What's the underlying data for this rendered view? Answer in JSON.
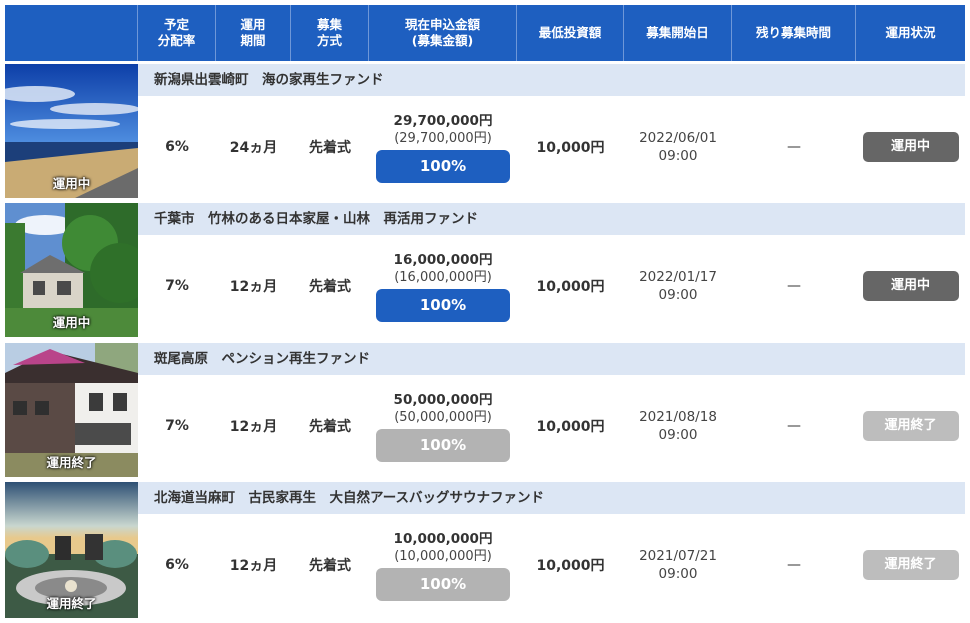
{
  "header": {
    "columns": [
      "予定\n分配率",
      "運用\n期間",
      "募集\n方式",
      "現在申込金額\n(募集金額)",
      "最低投資額",
      "募集開始日",
      "残り募集時間",
      "運用状況"
    ]
  },
  "funds": [
    {
      "name": "新潟県出雲崎町　海の家再生ファンド",
      "thumb_label": "運用中",
      "rate": "6%",
      "period": "24ヵ月",
      "method": "先着式",
      "amount": "29,700,000円",
      "target": "(29,700,000円)",
      "percent": "100%",
      "min_investment": "10,000円",
      "start_date": "2022/06/01\n09:00",
      "remaining": "—",
      "status": "運用中"
    },
    {
      "name": "千葉市　竹林のある日本家屋・山林　再活用ファンド",
      "thumb_label": "運用中",
      "rate": "7%",
      "period": "12ヵ月",
      "method": "先着式",
      "amount": "16,000,000円",
      "target": "(16,000,000円)",
      "percent": "100%",
      "min_investment": "10,000円",
      "start_date": "2022/01/17\n09:00",
      "remaining": "—",
      "status": "運用中"
    },
    {
      "name": "斑尾高原　ペンション再生ファンド",
      "thumb_label": "運用終了",
      "rate": "7%",
      "period": "12ヵ月",
      "method": "先着式",
      "amount": "50,000,000円",
      "target": "(50,000,000円)",
      "percent": "100%",
      "min_investment": "10,000円",
      "start_date": "2021/08/18\n09:00",
      "remaining": "—",
      "status": "運用終了"
    },
    {
      "name": "北海道当麻町　古民家再生　大自然アースバッグサウナファンド",
      "thumb_label": "運用終了",
      "rate": "6%",
      "period": "12ヵ月",
      "method": "先着式",
      "amount": "10,000,000円",
      "target": "(10,000,000円)",
      "percent": "100%",
      "min_investment": "10,000円",
      "start_date": "2021/07/21\n09:00",
      "remaining": "—",
      "status": "運用終了"
    }
  ],
  "colors": {
    "header_blue": "#1e5fc0",
    "name_bar": "#dce6f4",
    "running_button": "#666666",
    "ended_button": "#bdbdbd",
    "ended_bar": "#b3b3b3"
  }
}
